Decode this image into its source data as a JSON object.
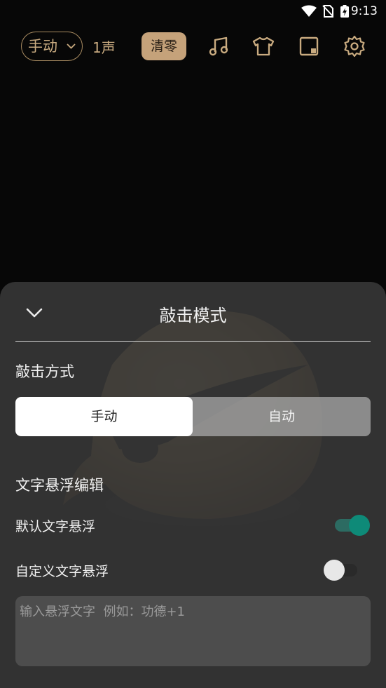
{
  "status_bar": {
    "time": "9:13"
  },
  "toolbar": {
    "mode_label": "手动",
    "count_label": "1声",
    "clear_label": "清零",
    "icons": [
      "music-icon",
      "shirt-icon",
      "square-icon",
      "gear-icon"
    ]
  },
  "sheet": {
    "title": "敲击模式",
    "tap_section_title": "敲击方式",
    "tap_options": [
      "手动",
      "自动"
    ],
    "selected_option": "手动",
    "float_section_title": "文字悬浮编辑",
    "default_float_label": "默认文字悬浮",
    "default_float_on": true,
    "custom_float_label": "自定义文字悬浮",
    "custom_float_on": false,
    "input_placeholder": "输入悬浮文字  例如：功德+1"
  },
  "colors": {
    "accent_gold": "#c9ab80",
    "clear_button_bg": "#c5a27a",
    "toggle_on": "#0e8a78",
    "sheet_bg": "#363636"
  }
}
